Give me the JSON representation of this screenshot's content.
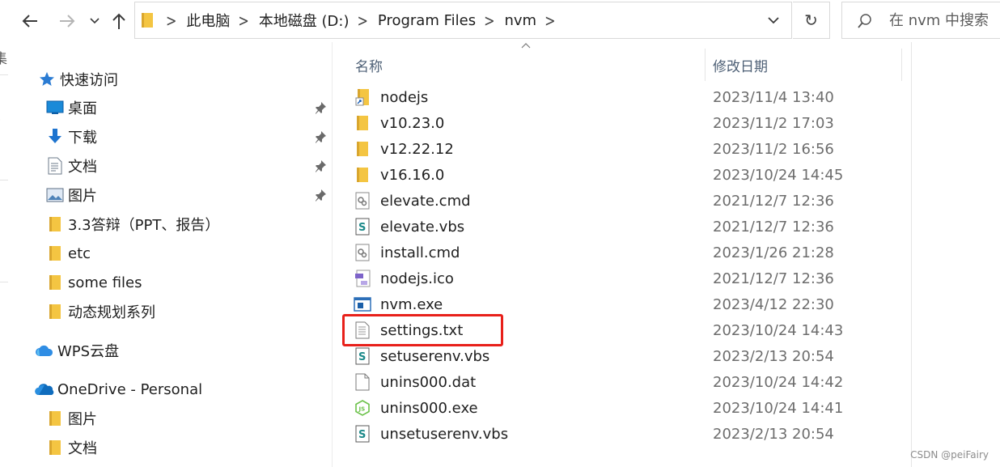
{
  "address_bar": {
    "breadcrumbs": [
      "此电脑",
      "本地磁盘 (D:)",
      "Program Files",
      "nvm"
    ]
  },
  "search": {
    "placeholder": "在 nvm 中搜索"
  },
  "nav_pane": {
    "quick_access": {
      "label": "快速访问",
      "items": [
        {
          "label": "桌面",
          "icon": "desktop-icon",
          "pinned": true
        },
        {
          "label": "下载",
          "icon": "download-icon",
          "pinned": true
        },
        {
          "label": "文档",
          "icon": "document-icon",
          "pinned": true
        },
        {
          "label": "图片",
          "icon": "picture-icon",
          "pinned": true
        },
        {
          "label": "3.3答辩（PPT、报告）",
          "icon": "folder-icon",
          "pinned": false
        },
        {
          "label": "etc",
          "icon": "folder-icon",
          "pinned": false
        },
        {
          "label": "some files",
          "icon": "folder-icon",
          "pinned": false
        },
        {
          "label": "动态规划系列",
          "icon": "folder-icon",
          "pinned": false
        }
      ]
    },
    "wps": {
      "label": "WPS云盘"
    },
    "onedrive": {
      "label": "OneDrive - Personal",
      "items": [
        {
          "label": "图片",
          "icon": "folder-icon"
        },
        {
          "label": "文档",
          "icon": "folder-icon"
        }
      ]
    }
  },
  "file_list": {
    "columns": {
      "name": "名称",
      "date_modified": "修改日期"
    },
    "files": [
      {
        "name": "nodejs",
        "date": "2023/11/4 13:40",
        "icon": "folder-shortcut-icon"
      },
      {
        "name": "v10.23.0",
        "date": "2023/11/2 17:03",
        "icon": "folder-icon"
      },
      {
        "name": "v12.22.12",
        "date": "2023/11/2 16:56",
        "icon": "folder-icon"
      },
      {
        "name": "v16.16.0",
        "date": "2023/10/24 14:45",
        "icon": "folder-icon"
      },
      {
        "name": "elevate.cmd",
        "date": "2021/12/7 12:36",
        "icon": "cmd-file-icon"
      },
      {
        "name": "elevate.vbs",
        "date": "2021/12/7 12:36",
        "icon": "vbs-file-icon"
      },
      {
        "name": "install.cmd",
        "date": "2023/1/26 21:28",
        "icon": "cmd-file-icon"
      },
      {
        "name": "nodejs.ico",
        "date": "2021/12/7 12:36",
        "icon": "ico-file-icon"
      },
      {
        "name": "nvm.exe",
        "date": "2023/4/12 22:30",
        "icon": "exe-file-icon"
      },
      {
        "name": "settings.txt",
        "date": "2023/10/24 14:43",
        "icon": "text-file-icon"
      },
      {
        "name": "setuserenv.vbs",
        "date": "2023/2/13 20:54",
        "icon": "vbs-file-icon"
      },
      {
        "name": "unins000.dat",
        "date": "2023/10/24 14:42",
        "icon": "blank-file-icon"
      },
      {
        "name": "unins000.exe",
        "date": "2023/10/24 14:41",
        "icon": "node-exe-icon"
      },
      {
        "name": "unsetuserenv.vbs",
        "date": "2023/2/13 20:54",
        "icon": "vbs-file-icon"
      }
    ]
  },
  "annotation": {
    "highlight_color": "#e8201a"
  },
  "watermark": "CSDN @peiFairy",
  "colors": {
    "folder": "#f4c542",
    "accent": "#1a73c8"
  }
}
